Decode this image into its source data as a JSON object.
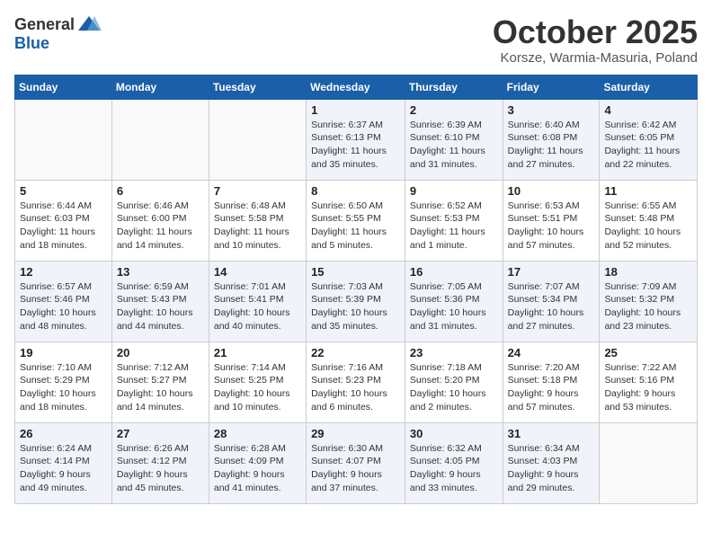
{
  "header": {
    "logo_general": "General",
    "logo_blue": "Blue",
    "month_title": "October 2025",
    "location": "Korsze, Warmia-Masuria, Poland"
  },
  "days_of_week": [
    "Sunday",
    "Monday",
    "Tuesday",
    "Wednesday",
    "Thursday",
    "Friday",
    "Saturday"
  ],
  "weeks": [
    [
      {
        "day": "",
        "info": ""
      },
      {
        "day": "",
        "info": ""
      },
      {
        "day": "",
        "info": ""
      },
      {
        "day": "1",
        "info": "Sunrise: 6:37 AM\nSunset: 6:13 PM\nDaylight: 11 hours and 35 minutes."
      },
      {
        "day": "2",
        "info": "Sunrise: 6:39 AM\nSunset: 6:10 PM\nDaylight: 11 hours and 31 minutes."
      },
      {
        "day": "3",
        "info": "Sunrise: 6:40 AM\nSunset: 6:08 PM\nDaylight: 11 hours and 27 minutes."
      },
      {
        "day": "4",
        "info": "Sunrise: 6:42 AM\nSunset: 6:05 PM\nDaylight: 11 hours and 22 minutes."
      }
    ],
    [
      {
        "day": "5",
        "info": "Sunrise: 6:44 AM\nSunset: 6:03 PM\nDaylight: 11 hours and 18 minutes."
      },
      {
        "day": "6",
        "info": "Sunrise: 6:46 AM\nSunset: 6:00 PM\nDaylight: 11 hours and 14 minutes."
      },
      {
        "day": "7",
        "info": "Sunrise: 6:48 AM\nSunset: 5:58 PM\nDaylight: 11 hours and 10 minutes."
      },
      {
        "day": "8",
        "info": "Sunrise: 6:50 AM\nSunset: 5:55 PM\nDaylight: 11 hours and 5 minutes."
      },
      {
        "day": "9",
        "info": "Sunrise: 6:52 AM\nSunset: 5:53 PM\nDaylight: 11 hours and 1 minute."
      },
      {
        "day": "10",
        "info": "Sunrise: 6:53 AM\nSunset: 5:51 PM\nDaylight: 10 hours and 57 minutes."
      },
      {
        "day": "11",
        "info": "Sunrise: 6:55 AM\nSunset: 5:48 PM\nDaylight: 10 hours and 52 minutes."
      }
    ],
    [
      {
        "day": "12",
        "info": "Sunrise: 6:57 AM\nSunset: 5:46 PM\nDaylight: 10 hours and 48 minutes."
      },
      {
        "day": "13",
        "info": "Sunrise: 6:59 AM\nSunset: 5:43 PM\nDaylight: 10 hours and 44 minutes."
      },
      {
        "day": "14",
        "info": "Sunrise: 7:01 AM\nSunset: 5:41 PM\nDaylight: 10 hours and 40 minutes."
      },
      {
        "day": "15",
        "info": "Sunrise: 7:03 AM\nSunset: 5:39 PM\nDaylight: 10 hours and 35 minutes."
      },
      {
        "day": "16",
        "info": "Sunrise: 7:05 AM\nSunset: 5:36 PM\nDaylight: 10 hours and 31 minutes."
      },
      {
        "day": "17",
        "info": "Sunrise: 7:07 AM\nSunset: 5:34 PM\nDaylight: 10 hours and 27 minutes."
      },
      {
        "day": "18",
        "info": "Sunrise: 7:09 AM\nSunset: 5:32 PM\nDaylight: 10 hours and 23 minutes."
      }
    ],
    [
      {
        "day": "19",
        "info": "Sunrise: 7:10 AM\nSunset: 5:29 PM\nDaylight: 10 hours and 18 minutes."
      },
      {
        "day": "20",
        "info": "Sunrise: 7:12 AM\nSunset: 5:27 PM\nDaylight: 10 hours and 14 minutes."
      },
      {
        "day": "21",
        "info": "Sunrise: 7:14 AM\nSunset: 5:25 PM\nDaylight: 10 hours and 10 minutes."
      },
      {
        "day": "22",
        "info": "Sunrise: 7:16 AM\nSunset: 5:23 PM\nDaylight: 10 hours and 6 minutes."
      },
      {
        "day": "23",
        "info": "Sunrise: 7:18 AM\nSunset: 5:20 PM\nDaylight: 10 hours and 2 minutes."
      },
      {
        "day": "24",
        "info": "Sunrise: 7:20 AM\nSunset: 5:18 PM\nDaylight: 9 hours and 57 minutes."
      },
      {
        "day": "25",
        "info": "Sunrise: 7:22 AM\nSunset: 5:16 PM\nDaylight: 9 hours and 53 minutes."
      }
    ],
    [
      {
        "day": "26",
        "info": "Sunrise: 6:24 AM\nSunset: 4:14 PM\nDaylight: 9 hours and 49 minutes."
      },
      {
        "day": "27",
        "info": "Sunrise: 6:26 AM\nSunset: 4:12 PM\nDaylight: 9 hours and 45 minutes."
      },
      {
        "day": "28",
        "info": "Sunrise: 6:28 AM\nSunset: 4:09 PM\nDaylight: 9 hours and 41 minutes."
      },
      {
        "day": "29",
        "info": "Sunrise: 6:30 AM\nSunset: 4:07 PM\nDaylight: 9 hours and 37 minutes."
      },
      {
        "day": "30",
        "info": "Sunrise: 6:32 AM\nSunset: 4:05 PM\nDaylight: 9 hours and 33 minutes."
      },
      {
        "day": "31",
        "info": "Sunrise: 6:34 AM\nSunset: 4:03 PM\nDaylight: 9 hours and 29 minutes."
      },
      {
        "day": "",
        "info": ""
      }
    ]
  ]
}
